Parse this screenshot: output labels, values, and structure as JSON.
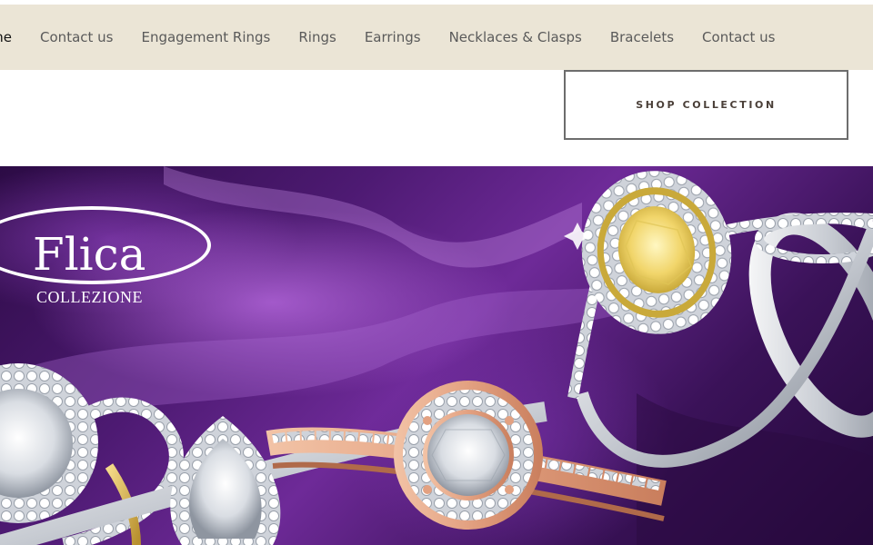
{
  "nav": {
    "items": [
      {
        "label": "ome",
        "active": true
      },
      {
        "label": "Contact us",
        "active": false
      },
      {
        "label": "Engagement Rings",
        "active": false
      },
      {
        "label": "Rings",
        "active": false
      },
      {
        "label": "Earrings",
        "active": false
      },
      {
        "label": "Necklaces & Clasps",
        "active": false
      },
      {
        "label": "Bracelets",
        "active": false
      },
      {
        "label": "Contact us",
        "active": false
      }
    ]
  },
  "cta": {
    "label": "SHOP COLLECTION"
  },
  "hero": {
    "logo_name": "Flica",
    "logo_sub": "COLLEZIONE",
    "colors": {
      "silk_dark": "#2c0b45",
      "silk_light": "#be6ee6",
      "nav_bg": "#ebe5d6"
    }
  }
}
